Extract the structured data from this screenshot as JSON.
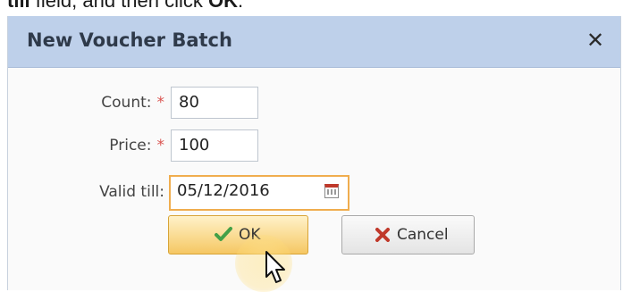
{
  "doc_instruction": {
    "bold_prefix": "till",
    "text_mid": " field, and then click ",
    "bold_ok": "OK",
    "text_end": "."
  },
  "dialog": {
    "title": "New Voucher Batch",
    "close_glyph": "✕",
    "fields": {
      "count": {
        "label": "Count:",
        "required_mark": "*",
        "value": "80"
      },
      "price": {
        "label": "Price:",
        "required_mark": "*",
        "value": "100"
      },
      "valid_till": {
        "label": "Valid till:",
        "value": "05/12/2016",
        "icon": "calendar-icon"
      }
    },
    "buttons": {
      "ok_label": "OK",
      "ok_icon": "check-icon",
      "cancel_label": "Cancel",
      "cancel_icon": "x-icon"
    }
  },
  "colors": {
    "title_bar": "#bed0ea",
    "required": "#d9534f",
    "focus_border": "#f0ad4e",
    "ok_button": "#f5c763",
    "check_icon": "#43a047",
    "cancel_icon": "#c0392b"
  }
}
